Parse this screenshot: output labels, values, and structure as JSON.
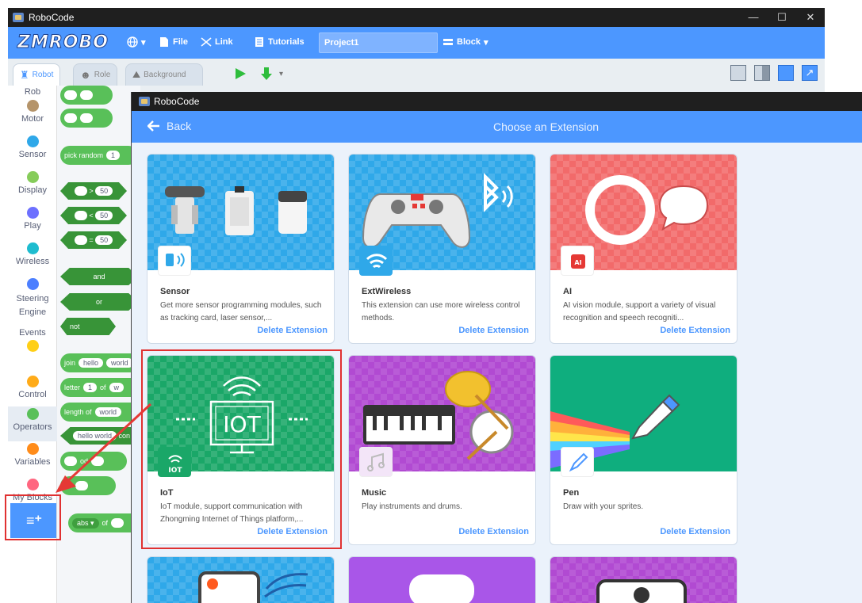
{
  "main_window": {
    "title": "RoboCode",
    "menu": {
      "logo": "ZMROBO",
      "file": "File",
      "link": "Link",
      "tutorials": "Tutorials",
      "project_name": "Project1",
      "block": "Block"
    },
    "tabs": [
      {
        "label": "Robot"
      },
      {
        "label": "Role"
      },
      {
        "label": "Background"
      }
    ]
  },
  "categories": [
    {
      "label": "Rob",
      "color": "#4c97ff"
    },
    {
      "label": "Motor",
      "color": "#b5946a"
    },
    {
      "label": "Sensor",
      "color": "#2fa8e9"
    },
    {
      "label": "Display",
      "color": "#86cc5a"
    },
    {
      "label": "Play",
      "color": "#6d70ff"
    },
    {
      "label": "Wireless",
      "color": "#1ebccf"
    },
    {
      "label": "Steering Engine",
      "color": "#4c7fff"
    },
    {
      "label": "Events",
      "color": "#ffcf16"
    },
    {
      "label": "Control",
      "color": "#ffab19"
    },
    {
      "label": "Operators",
      "color": "#59c059"
    },
    {
      "label": "Variables",
      "color": "#ff8c1a"
    },
    {
      "label": "My Blocks",
      "color": "#ff6680"
    }
  ],
  "palette": {
    "pick_random": "pick random",
    "pick_random_val": "1",
    "gt": ">",
    "lt": "<",
    "eq": "=",
    "cmp_val": "50",
    "and": "and",
    "or": "or",
    "not": "not",
    "join": "join",
    "join_a": "hello",
    "join_b": "world",
    "letter": "letter",
    "letter_val": "1",
    "of": "of",
    "of_val": "w",
    "length_of": "length of",
    "length_val": "world",
    "contains_a": "hello world",
    "contains_b": "con",
    "mod": "od",
    "round": "nd",
    "abs": "abs",
    "abs_of": "of"
  },
  "extension_window": {
    "title": "RoboCode",
    "back": "Back",
    "heading": "Choose an Extension",
    "cards": [
      {
        "name": "Sensor",
        "desc": "Get more sensor programming modules, such as tracking card, laser sensor,...",
        "delete": "Delete Extension"
      },
      {
        "name": "ExtWireless",
        "desc": "This extension can use more wireless control methods.",
        "delete": "Delete Extension"
      },
      {
        "name": "AI",
        "desc": "AI vision module, support a variety of visual recognition and speech recogniti...",
        "delete": "Delete Extension"
      },
      {
        "name": "IoT",
        "desc": "IoT module, support communication with Zhongming Internet of Things platform,...",
        "delete": "Delete Extension",
        "banner_text": "IOT"
      },
      {
        "name": "Music",
        "desc": "Play instruments and drums.",
        "delete": "Delete Extension"
      },
      {
        "name": "Pen",
        "desc": "Draw with your sprites.",
        "delete": "Delete Extension"
      }
    ]
  },
  "colors": {
    "accent": "#4c97ff",
    "highlight": "#e03131"
  }
}
